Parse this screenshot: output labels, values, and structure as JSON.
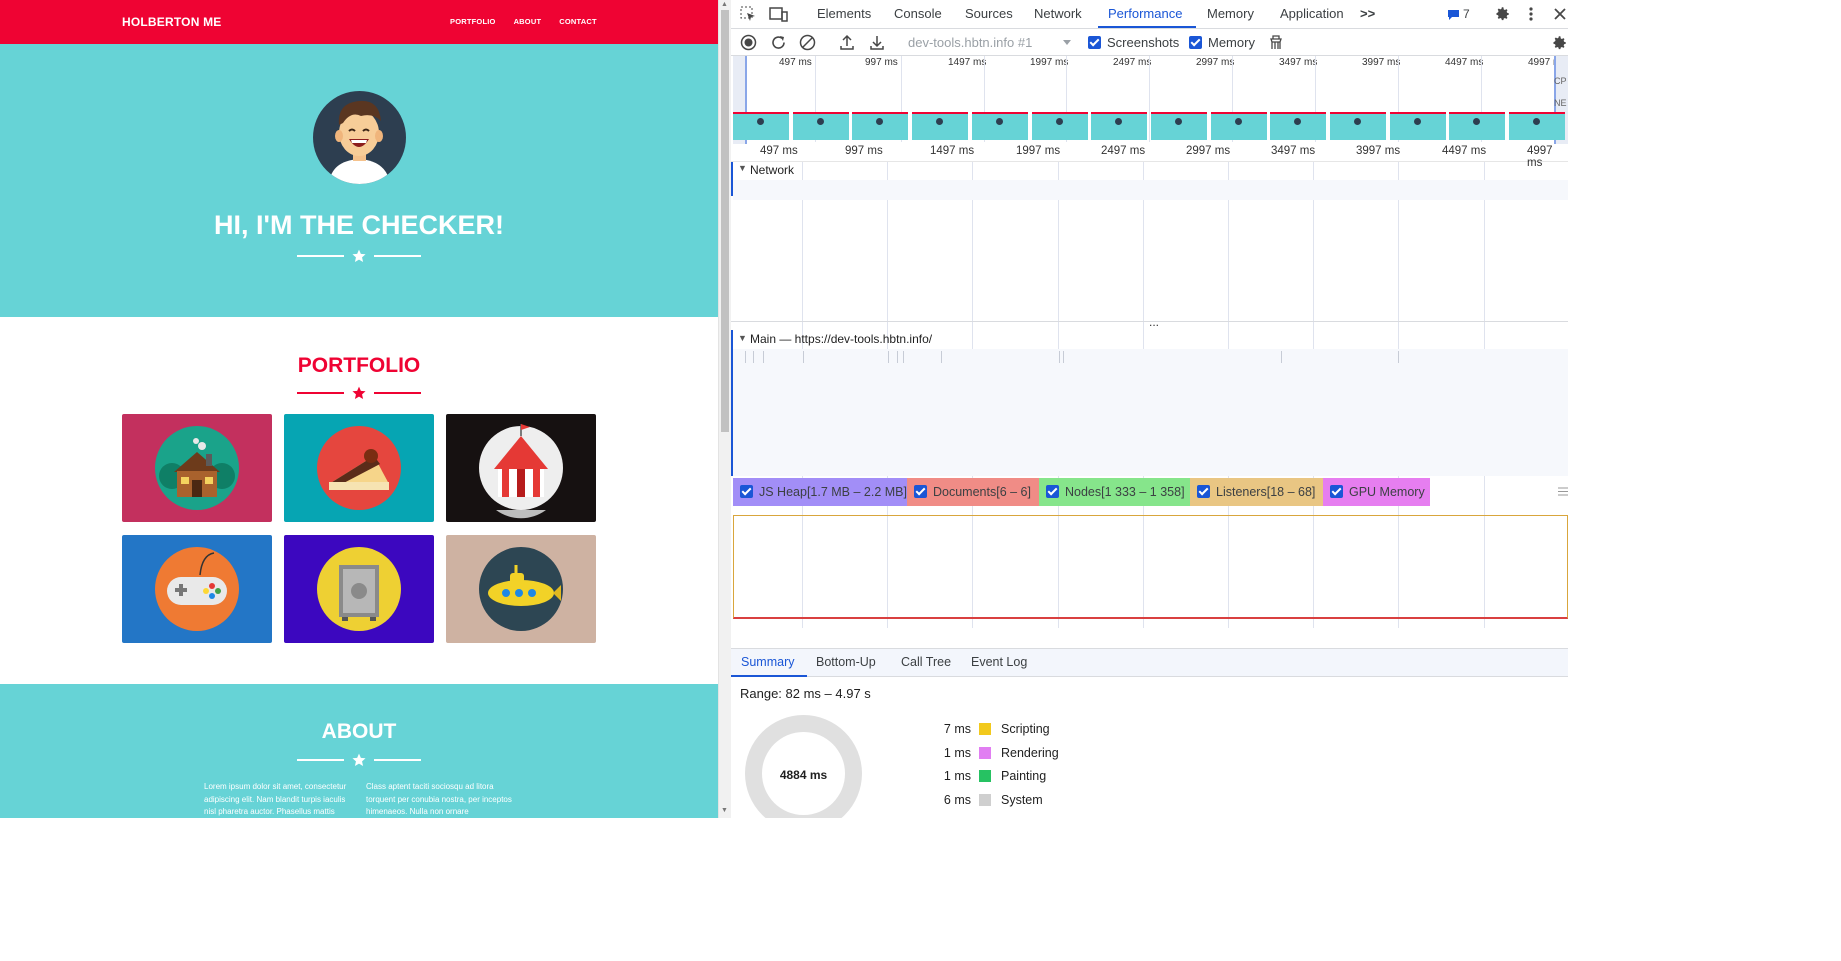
{
  "website": {
    "brand": "HOLBERTON ME",
    "nav_links": [
      "PORTFOLIO",
      "ABOUT",
      "CONTACT"
    ],
    "hero_title": "HI, I'M THE CHECKER!",
    "portfolio_title": "PORTFOLIO",
    "about_title": "ABOUT",
    "about_col1": "Lorem ipsum dolor sit amet, consectetur adipiscing elit. Nam blandit turpis iaculis nisl pharetra auctor. Phasellus mattis",
    "about_col2": "Class aptent taciti sociosqu ad litora torquent per conubia nostra, per inceptos himenaeos. Nulla non ornare",
    "portfolio_tiles": [
      {
        "icon": "cabin-icon",
        "bg": "#c3305e",
        "circle": "#1aa38a"
      },
      {
        "icon": "cake-icon",
        "bg": "#06a5b3",
        "circle": "#e5463e"
      },
      {
        "icon": "circus-tent-icon",
        "bg": "#161111",
        "circle": "#eeeeee"
      },
      {
        "icon": "game-controller-icon",
        "bg": "#2376c6",
        "circle": "#ef7a33"
      },
      {
        "icon": "safe-icon",
        "bg": "#3c07bf",
        "circle": "#eed033"
      },
      {
        "icon": "submarine-icon",
        "bg": "#ceb2a2",
        "circle": "#2d4653"
      }
    ],
    "colors": {
      "accent": "#ef0333",
      "teal": "#66d3d6"
    }
  },
  "devtools": {
    "tabs": [
      "Elements",
      "Console",
      "Sources",
      "Network",
      "Performance",
      "Memory",
      "Application"
    ],
    "active_tab": "Performance",
    "more_tabs": ">>",
    "issues_count": "7",
    "recording_target": "dev-tools.hbtn.info #1",
    "screenshots_label": "Screenshots",
    "memory_label": "Memory",
    "overview_ticks": [
      "497 ms",
      "997 ms",
      "1497 ms",
      "1997 ms",
      "2497 ms",
      "2997 ms",
      "3497 ms",
      "3997 ms",
      "4497 ms",
      "4997 ms"
    ],
    "overview_side_labels": [
      "CP",
      "NE"
    ],
    "network_track": "Network",
    "main_track": "Main — https://dev-tools.hbtn.info/",
    "resize_handle": "...",
    "counters": [
      {
        "label": "JS Heap[1.7 MB – 2.2 MB]",
        "color": "#a28ef7"
      },
      {
        "label": "Documents[6 – 6]",
        "color": "#f08c86"
      },
      {
        "label": "Nodes[1 333 – 1 358]",
        "color": "#86e58b"
      },
      {
        "label": "Listeners[18 – 68]",
        "color": "#e9c683"
      },
      {
        "label": "GPU Memory",
        "color": "#e67ef0"
      }
    ],
    "bottom_tabs": [
      "Summary",
      "Bottom-Up",
      "Call Tree",
      "Event Log"
    ],
    "active_bottom_tab": "Summary",
    "range": "Range: 82 ms – 4.97 s",
    "total": "4884 ms",
    "summary": [
      {
        "ms": "7 ms",
        "name": "Scripting",
        "color": "#f2c91d"
      },
      {
        "ms": "1 ms",
        "name": "Rendering",
        "color": "#e17ef2"
      },
      {
        "ms": "1 ms",
        "name": "Painting",
        "color": "#26c262"
      },
      {
        "ms": "6 ms",
        "name": "System",
        "color": "#cfcfcf"
      }
    ]
  }
}
